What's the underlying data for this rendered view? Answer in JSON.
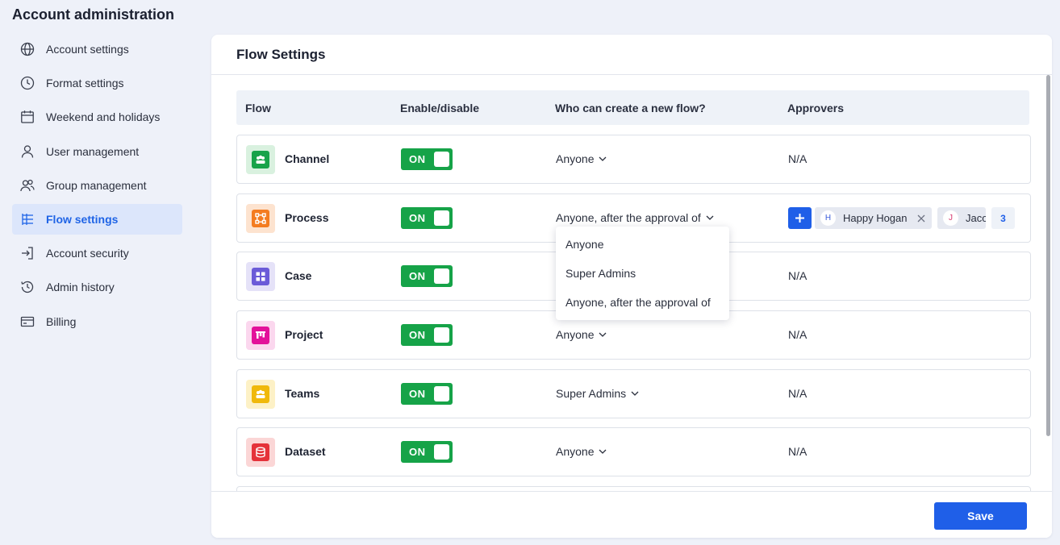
{
  "app": {
    "title": "Account administration"
  },
  "sidebar": {
    "items": [
      {
        "label": "Account settings",
        "icon": "globe-icon",
        "active": false
      },
      {
        "label": "Format settings",
        "icon": "clock-icon",
        "active": false
      },
      {
        "label": "Weekend and holidays",
        "icon": "calendar-icon",
        "active": false
      },
      {
        "label": "User management",
        "icon": "user-icon",
        "active": false
      },
      {
        "label": "Group management",
        "icon": "users-icon",
        "active": false
      },
      {
        "label": "Flow settings",
        "icon": "flow-tree-icon",
        "active": true
      },
      {
        "label": "Account security",
        "icon": "sign-in-icon",
        "active": false
      },
      {
        "label": "Admin history",
        "icon": "history-icon",
        "active": false
      },
      {
        "label": "Billing",
        "icon": "credit-card-icon",
        "active": false
      }
    ]
  },
  "panel": {
    "title": "Flow Settings",
    "columns": {
      "flow": "Flow",
      "enable": "Enable/disable",
      "who": "Who can create a new flow?",
      "approvers": "Approvers"
    },
    "rows": [
      {
        "name": "Channel",
        "toggle": "ON",
        "who": "Anyone",
        "approvers": "N/A",
        "icon": "channel-icon",
        "color": "#18a34a",
        "bg": "#d9f1df"
      },
      {
        "name": "Process",
        "toggle": "ON",
        "who": "Anyone, after the approval of",
        "approvers": "",
        "icon": "process-icon",
        "color": "#f47c20",
        "bg": "#fde3cf"
      },
      {
        "name": "Case",
        "toggle": "ON",
        "who": "",
        "approvers": "N/A",
        "icon": "case-icon",
        "color": "#6b5bd8",
        "bg": "#e5e2f8"
      },
      {
        "name": "Project",
        "toggle": "ON",
        "who": "Anyone",
        "approvers": "N/A",
        "icon": "project-icon",
        "color": "#e3119a",
        "bg": "#fbd7ee"
      },
      {
        "name": "Teams",
        "toggle": "ON",
        "who": "Super Admins",
        "approvers": "N/A",
        "icon": "teams-icon",
        "color": "#f0b90b",
        "bg": "#fdf1c6"
      },
      {
        "name": "Dataset",
        "toggle": "ON",
        "who": "Anyone",
        "approvers": "N/A",
        "icon": "dataset-icon",
        "color": "#e5323a",
        "bg": "#fbd6d6"
      }
    ],
    "process_approvers": {
      "chips": [
        {
          "initial": "H",
          "name": "Happy Hogan",
          "avatar_color": "#3b5bdb"
        },
        {
          "initial": "J",
          "name": "Jacob",
          "avatar_color": "#d6336c"
        }
      ],
      "more_count": "3"
    },
    "dropdown": {
      "options": [
        "Anyone",
        "Super Admins",
        "Anyone, after the approval of"
      ]
    },
    "save_label": "Save"
  }
}
